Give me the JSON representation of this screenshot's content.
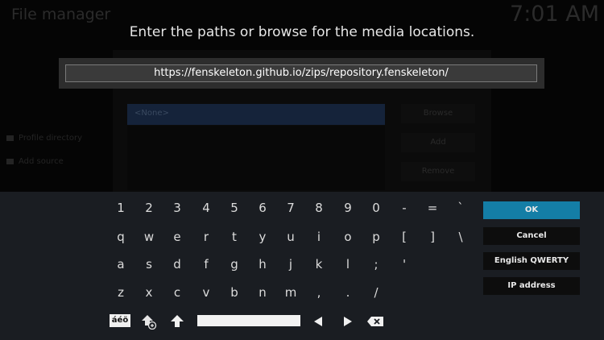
{
  "background": {
    "title": "File manager",
    "clock": "7:01 AM",
    "sidebar": [
      "Profile directory",
      "Add source"
    ],
    "dialog": {
      "selected_row": "<None>",
      "buttons": [
        "Browse",
        "Add",
        "Remove"
      ]
    }
  },
  "prompt": "Enter the paths or browse for the media locations.",
  "input": {
    "value": "https://fenskeleton.github.io/zips/repository.fenskeleton/"
  },
  "keyboard": {
    "rows": [
      [
        "1",
        "2",
        "3",
        "4",
        "5",
        "6",
        "7",
        "8",
        "9",
        "0",
        "-",
        "=",
        "`"
      ],
      [
        "q",
        "w",
        "e",
        "r",
        "t",
        "y",
        "u",
        "i",
        "o",
        "p",
        "[",
        "]",
        "\\"
      ],
      [
        "a",
        "s",
        "d",
        "f",
        "g",
        "h",
        "j",
        "k",
        "l",
        ";",
        "'"
      ],
      [
        "z",
        "x",
        "c",
        "v",
        "b",
        "n",
        "m",
        ",",
        ".",
        "/"
      ]
    ],
    "special": {
      "accents_label": "áéö",
      "icons": [
        "symbols-shift-icon",
        "shift-icon",
        "space-bar",
        "left-arrow-icon",
        "right-arrow-icon",
        "backspace-icon"
      ]
    },
    "actions": {
      "ok": "OK",
      "cancel": "Cancel",
      "layout": "English QWERTY",
      "ip": "IP address"
    }
  },
  "colors": {
    "accent": "#147ea6",
    "panel": "#1a1d22",
    "input_bg": "#3a3a3a"
  }
}
